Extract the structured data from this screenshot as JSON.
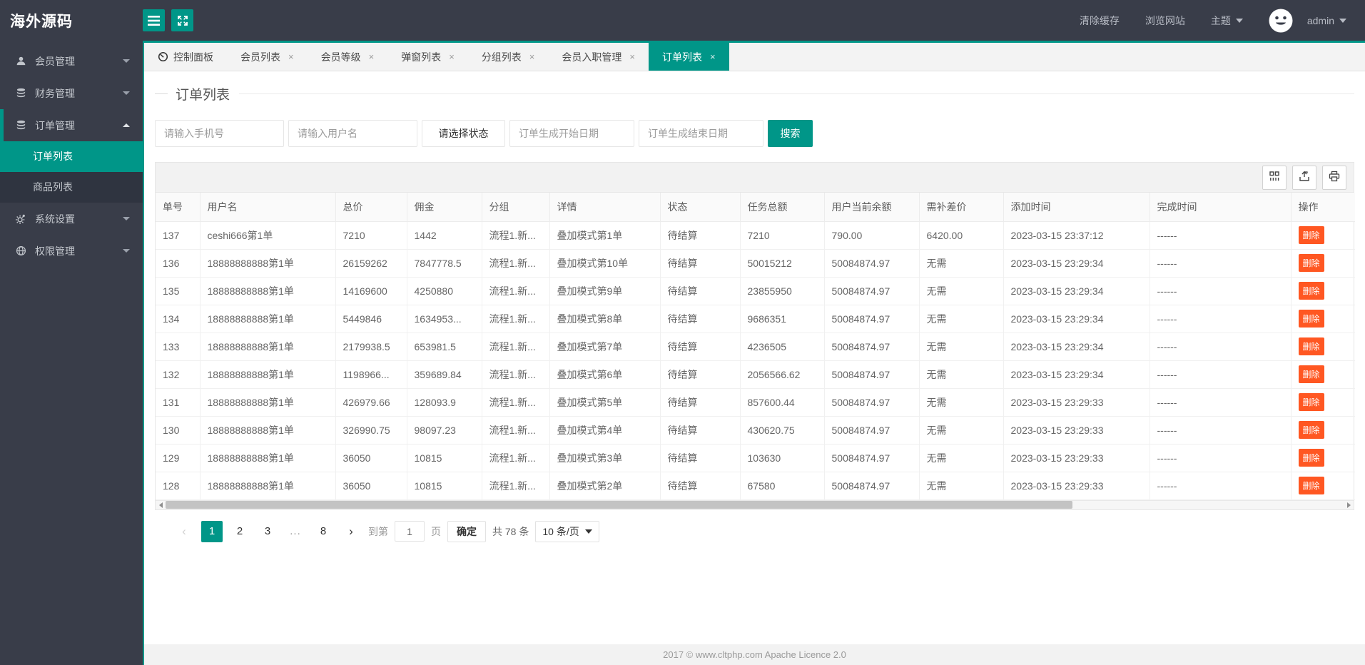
{
  "header": {
    "logo": "海外源码",
    "clear_cache": "清除缓存",
    "browse_site": "浏览网站",
    "theme": "主题",
    "username": "admin"
  },
  "sidebar": {
    "items": [
      {
        "id": "member",
        "label": "会员管理",
        "icon": "user-icon",
        "state": "collapsed"
      },
      {
        "id": "finance",
        "label": "财务管理",
        "icon": "database-icon",
        "state": "collapsed"
      },
      {
        "id": "order",
        "label": "订单管理",
        "icon": "database-icon",
        "state": "expanded",
        "children": [
          {
            "id": "order-list",
            "label": "订单列表",
            "active": true
          },
          {
            "id": "goods-list",
            "label": "商品列表",
            "active": false
          }
        ]
      },
      {
        "id": "system",
        "label": "系统设置",
        "icon": "gear-icon",
        "state": "collapsed"
      },
      {
        "id": "permission",
        "label": "权限管理",
        "icon": "globe-icon",
        "state": "collapsed"
      }
    ]
  },
  "tabs": [
    {
      "id": "dashboard",
      "label": "控制面板",
      "icon": "console-icon",
      "closable": false,
      "active": false
    },
    {
      "id": "member-list",
      "label": "会员列表",
      "closable": true,
      "active": false
    },
    {
      "id": "member-level",
      "label": "会员等级",
      "closable": true,
      "active": false
    },
    {
      "id": "popup-list",
      "label": "弹窗列表",
      "closable": true,
      "active": false
    },
    {
      "id": "group-list",
      "label": "分组列表",
      "closable": true,
      "active": false
    },
    {
      "id": "member-entry",
      "label": "会员入职管理",
      "closable": true,
      "active": false
    },
    {
      "id": "order-list",
      "label": "订单列表",
      "closable": true,
      "active": true
    }
  ],
  "page": {
    "title": "订单列表"
  },
  "search": {
    "phone_placeholder": "请输入手机号",
    "username_placeholder": "请输入用户名",
    "status_label": "请选择状态",
    "start_date_placeholder": "订单生成开始日期",
    "end_date_placeholder": "订单生成结束日期",
    "submit_label": "搜索"
  },
  "table": {
    "columns": [
      "单号",
      "用户名",
      "总价",
      "佣金",
      "分组",
      "详情",
      "状态",
      "任务总额",
      "用户当前余额",
      "需补差价",
      "添加时间",
      "完成时间",
      "操作"
    ],
    "action_label": "删除",
    "rows": [
      [
        "137",
        "ceshi666第1单",
        "7210",
        "1442",
        "流程1.新...",
        "叠加模式第1单",
        "待结算",
        "7210",
        "790.00",
        "6420.00",
        "2023-03-15 23:37:12",
        "------"
      ],
      [
        "136",
        "18888888888第1单",
        "26159262",
        "7847778.5",
        "流程1.新...",
        "叠加模式第10单",
        "待结算",
        "50015212",
        "50084874.97",
        "无需",
        "2023-03-15 23:29:34",
        "------"
      ],
      [
        "135",
        "18888888888第1单",
        "14169600",
        "4250880",
        "流程1.新...",
        "叠加模式第9单",
        "待结算",
        "23855950",
        "50084874.97",
        "无需",
        "2023-03-15 23:29:34",
        "------"
      ],
      [
        "134",
        "18888888888第1单",
        "5449846",
        "1634953...",
        "流程1.新...",
        "叠加模式第8单",
        "待结算",
        "9686351",
        "50084874.97",
        "无需",
        "2023-03-15 23:29:34",
        "------"
      ],
      [
        "133",
        "18888888888第1单",
        "2179938.5",
        "653981.5",
        "流程1.新...",
        "叠加模式第7单",
        "待结算",
        "4236505",
        "50084874.97",
        "无需",
        "2023-03-15 23:29:34",
        "------"
      ],
      [
        "132",
        "18888888888第1单",
        "1198966...",
        "359689.84",
        "流程1.新...",
        "叠加模式第6单",
        "待结算",
        "2056566.62",
        "50084874.97",
        "无需",
        "2023-03-15 23:29:34",
        "------"
      ],
      [
        "131",
        "18888888888第1单",
        "426979.66",
        "128093.9",
        "流程1.新...",
        "叠加模式第5单",
        "待结算",
        "857600.44",
        "50084874.97",
        "无需",
        "2023-03-15 23:29:33",
        "------"
      ],
      [
        "130",
        "18888888888第1单",
        "326990.75",
        "98097.23",
        "流程1.新...",
        "叠加模式第4单",
        "待结算",
        "430620.75",
        "50084874.97",
        "无需",
        "2023-03-15 23:29:33",
        "------"
      ],
      [
        "129",
        "18888888888第1单",
        "36050",
        "10815",
        "流程1.新...",
        "叠加模式第3单",
        "待结算",
        "103630",
        "50084874.97",
        "无需",
        "2023-03-15 23:29:33",
        "------"
      ],
      [
        "128",
        "18888888888第1单",
        "36050",
        "10815",
        "流程1.新...",
        "叠加模式第2单",
        "待结算",
        "67580",
        "50084874.97",
        "无需",
        "2023-03-15 23:29:33",
        "------"
      ]
    ]
  },
  "pagination": {
    "prev": "‹",
    "next": "›",
    "pages": [
      "1",
      "2",
      "3",
      "...",
      "8"
    ],
    "active_page": "1",
    "jump_prefix": "到第",
    "jump_value": "1",
    "jump_suffix": "页",
    "confirm_label": "确定",
    "total_text": "共 78 条",
    "page_size": "10 条/页"
  },
  "footer": {
    "text": "2017 ©  www.cltphp.com  Apache Licence 2.0"
  },
  "colors": {
    "accent": "#009688",
    "danger": "#FF5722",
    "header_bg": "#393D49"
  }
}
